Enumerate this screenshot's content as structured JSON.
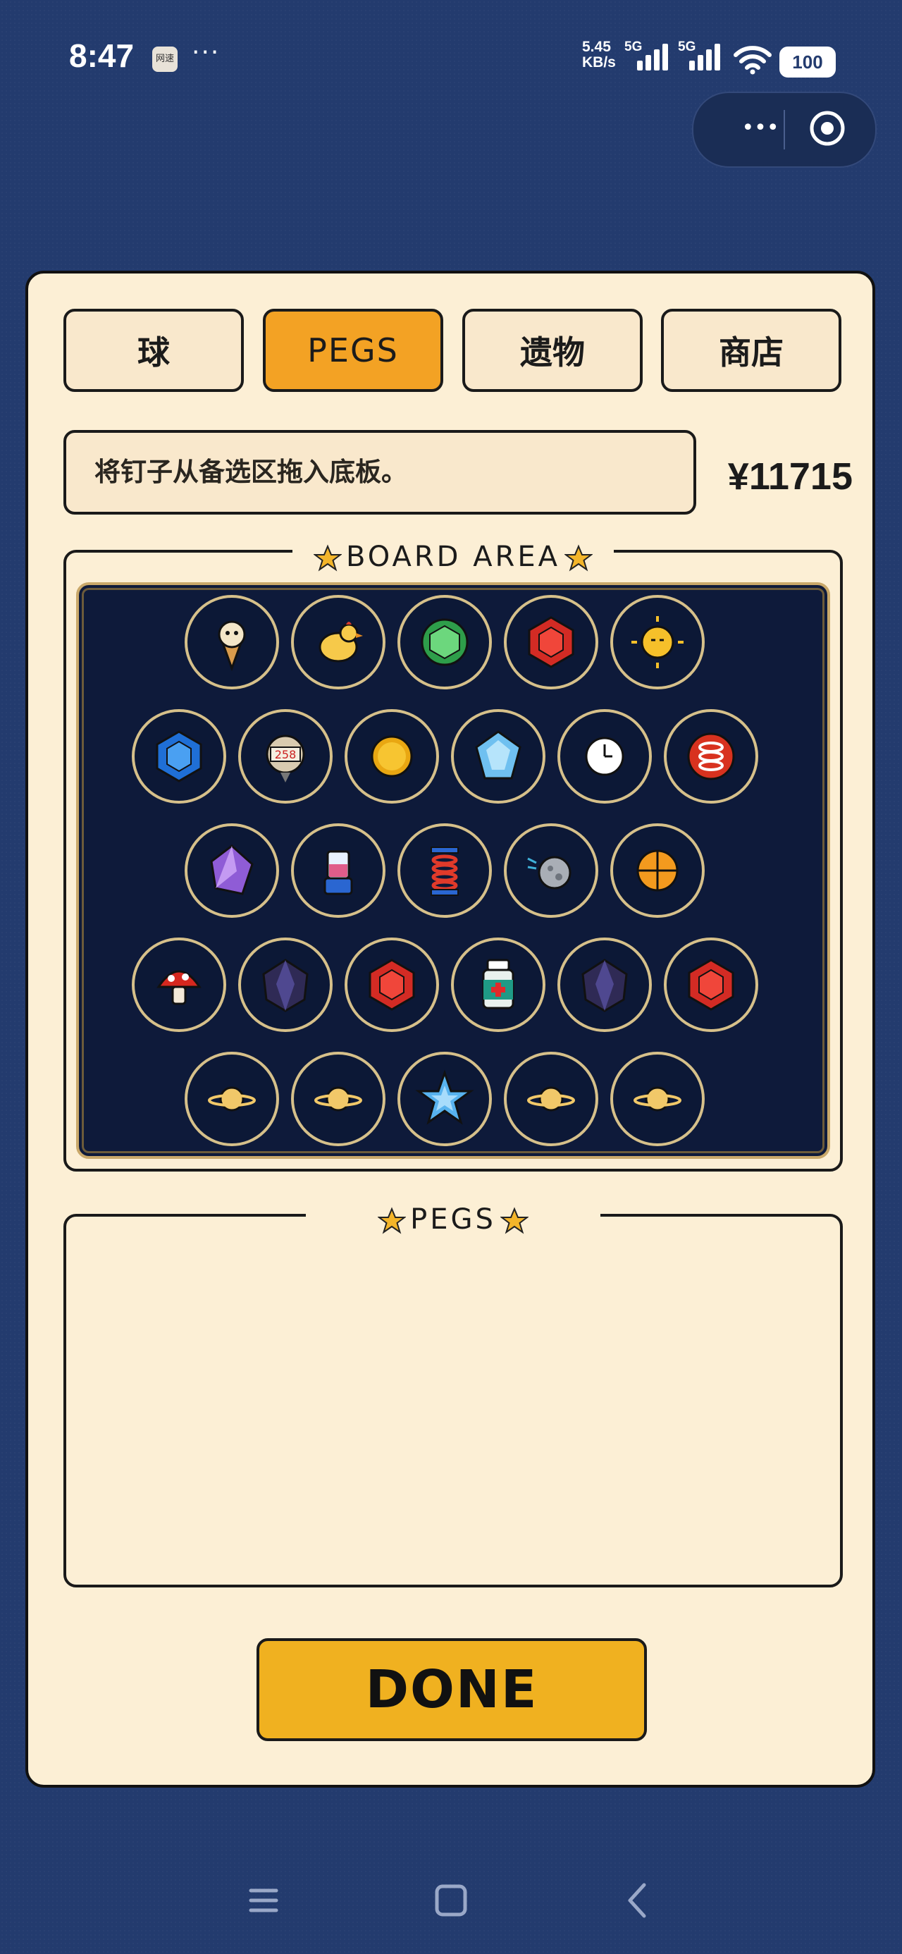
{
  "status_bar": {
    "time": "8:47",
    "app_icon_text": "网速",
    "dots": "···",
    "net_speed_value": "5.45",
    "net_speed_unit": "KB/s",
    "signal1_label": "5G",
    "signal2_label": "5G",
    "battery": "100",
    "icons": [
      "network-speed",
      "signal-icon",
      "signal-icon",
      "wifi-icon",
      "battery-icon"
    ]
  },
  "capsule": {
    "more_label": "•••",
    "icons": [
      "more-icon",
      "target-icon"
    ]
  },
  "tabs": [
    {
      "label": "球",
      "active": false
    },
    {
      "label": "PEGS",
      "active": true
    },
    {
      "label": "遗物",
      "active": false
    },
    {
      "label": "商店",
      "active": false
    }
  ],
  "hint": "将钉子从备选区拖入底板。",
  "money": "¥11715",
  "board_section": {
    "title": "BOARD AREA"
  },
  "board_rows": [
    [
      "ice-cream",
      "chicken",
      "green-gem",
      "red-gem",
      "sun-face"
    ],
    [
      "blue-gem",
      "counter-258",
      "gold-coin",
      "diamond",
      "clock",
      "red-spring"
    ],
    [
      "purple-crystal",
      "blender",
      "spring",
      "moon-rock",
      "orange-slice"
    ],
    [
      "mushroom",
      "dark-crystal",
      "red-gem",
      "medicine-bottle",
      "dark-crystal",
      "red-gem"
    ],
    [
      "planet",
      "planet",
      "blue-star",
      "planet",
      "planet"
    ]
  ],
  "counter_text": "258",
  "pegs_section": {
    "title": "PEGS"
  },
  "done_label": "DONE",
  "accent_colors": {
    "active_tab": "#f3a224",
    "done_button": "#f0b120",
    "panel": "#fcefd5",
    "board": "#0e1a3a"
  },
  "nav_icons": [
    "menu-icon",
    "home-icon",
    "back-icon"
  ]
}
